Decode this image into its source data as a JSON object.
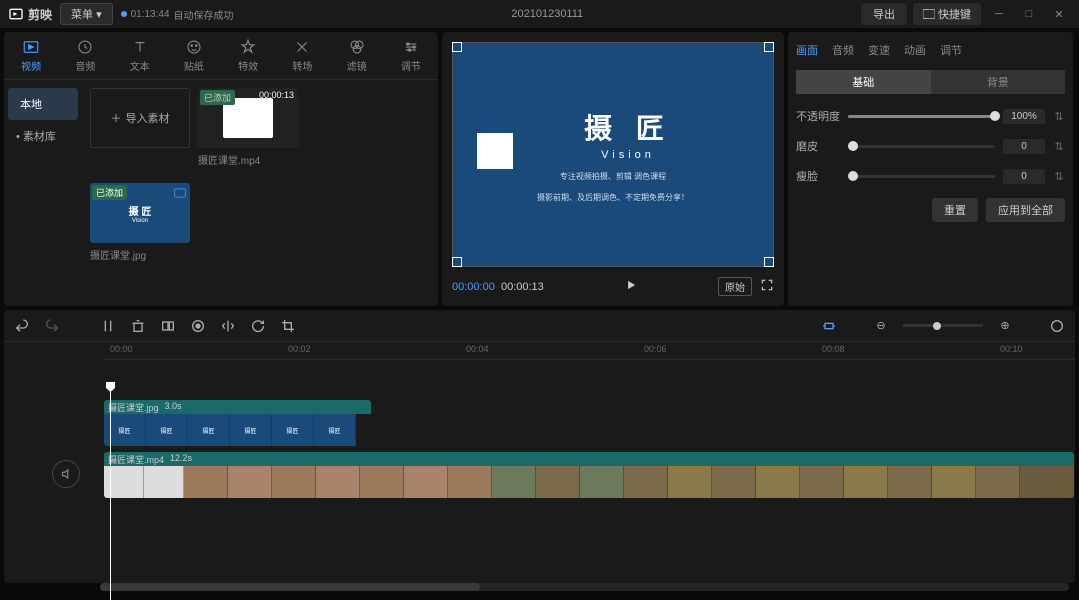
{
  "titlebar": {
    "app_name": "剪映",
    "menu": "菜单",
    "autosave_time": "01:13:44",
    "autosave_text": "自动保存成功",
    "project_title": "202101230111",
    "export": "导出",
    "shortcuts": "快捷键"
  },
  "tool_tabs": [
    {
      "label": "视频",
      "icon": "video"
    },
    {
      "label": "音频",
      "icon": "audio"
    },
    {
      "label": "文本",
      "icon": "text"
    },
    {
      "label": "贴纸",
      "icon": "sticker"
    },
    {
      "label": "特效",
      "icon": "effect"
    },
    {
      "label": "转场",
      "icon": "transition"
    },
    {
      "label": "滤镜",
      "icon": "filter"
    },
    {
      "label": "调节",
      "icon": "adjust"
    }
  ],
  "side_tabs": {
    "local": "本地",
    "library": "• 素材库"
  },
  "import_label": "导入素材",
  "media": [
    {
      "name": "摄匠课堂.mp4",
      "duration": "00:00:13",
      "badge": "已添加",
      "type": "video"
    },
    {
      "name": "摄匠课堂.jpg",
      "badge": "已添加",
      "type": "image"
    }
  ],
  "preview": {
    "title": "摄 匠",
    "subtitle": "Vision",
    "line1": "专注视频拍摄、剪辑 调色课程",
    "line2": "摄影前期、及后期调色、不定期免费分享！",
    "current": "00:00:00",
    "total": "00:00:13",
    "ratio": "原始"
  },
  "props": {
    "tabs": [
      "画面",
      "音频",
      "变速",
      "动画",
      "调节"
    ],
    "sub_tabs": [
      "基础",
      "背景"
    ],
    "opacity_label": "不透明度",
    "opacity_value": "100%",
    "smooth_label": "磨皮",
    "smooth_value": "0",
    "slim_label": "瘦脸",
    "slim_value": "0",
    "reset": "重置",
    "apply_all": "应用到全部"
  },
  "timeline": {
    "ticks": [
      "00:00",
      "00:02",
      "00:04",
      "00:06",
      "00:08",
      "00:10"
    ],
    "clip1": {
      "name": "摄匠课堂.jpg",
      "dur": "3.0s"
    },
    "clip2": {
      "name": "摄匠课堂.mp4",
      "dur": "12.2s"
    }
  }
}
